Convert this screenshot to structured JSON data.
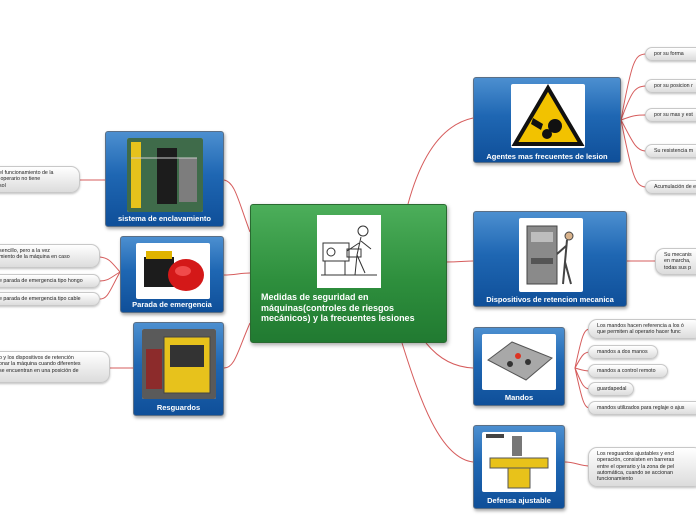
{
  "central": {
    "title": "Medidas de seguridad en máquinas(controles de riesgos mecánicos)  y la frecuentes lesiones"
  },
  "nodes": {
    "agentes": {
      "label": "Agentes mas frecuentes de lesion"
    },
    "dispositivos": {
      "label": "Dispositivos de retencion mecanica"
    },
    "mandos": {
      "label": "Mandos"
    },
    "defensa": {
      "label": "Defensa ajustable"
    },
    "enclavamiento": {
      "label": "sistema de enclavamiento"
    },
    "parada": {
      "label": "Parada de emergencia"
    },
    "resguardos": {
      "label": "Resguardos"
    }
  },
  "leaves": {
    "agentes": [
      "por su forma",
      "por su posicion r",
      "por su mas y est",
      "Su resistencia m",
      "Acumulación de e"
    ],
    "dispositivos": [
      "Su mecanis\nen marcha,\ntodas sus p"
    ],
    "mandos": [
      "Los mandos hacen referencia a los ó\nque permiten al operario hacer func",
      "mandos a dos manos",
      "mandos a control remoto",
      "guardapedal",
      "mandos utilizados para reglaje o ajus"
    ],
    "defensa": [
      "Los resguardos ajustables y encl\noperación, consisten en barreras\nentre el operario y la zona de pel\nautomática, cuando se accionan \nfuncionamiento"
    ],
    "enclavamiento": [
      "el funcionamiento de la\n operario no tiene\nsol"
    ],
    "parada": [
      "sencillo, pero a la vez\nmiento de la máquina en caso",
      "e parada de emergencia tipo hongo",
      "e parada de emergencia tipo cable"
    ],
    "resguardos": [
      "o y los dispositivos de retención\nonar la máquina cuando diferentes\nse encuentran en una posición de"
    ]
  },
  "colors": {
    "link": "#d65c5c",
    "central_fill": "#2e8f3d",
    "node_fill": "#1f67b3"
  }
}
